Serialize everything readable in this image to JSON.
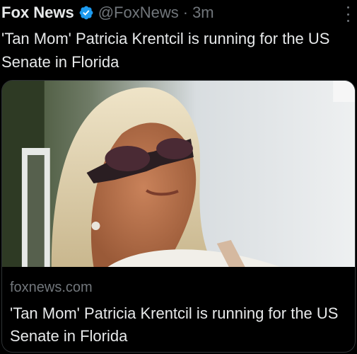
{
  "tweet": {
    "author_name": "Fox News",
    "handle": "@FoxNews",
    "separator": "·",
    "time": "3m",
    "text": "'Tan Mom' Patricia Krentcil is running for the US Senate in Florida"
  },
  "card": {
    "domain": "foxnews.com",
    "title": "'Tan Mom' Patricia Krentcil is running for the US Senate in Florida"
  },
  "icons": {
    "verified": "verified-badge-icon",
    "more": "more-options-icon"
  },
  "colors": {
    "background": "#000000",
    "text_primary": "#e7e9ea",
    "text_secondary": "#71767b",
    "verified_badge": "#1d9bf0",
    "card_border": "#2f3336"
  }
}
